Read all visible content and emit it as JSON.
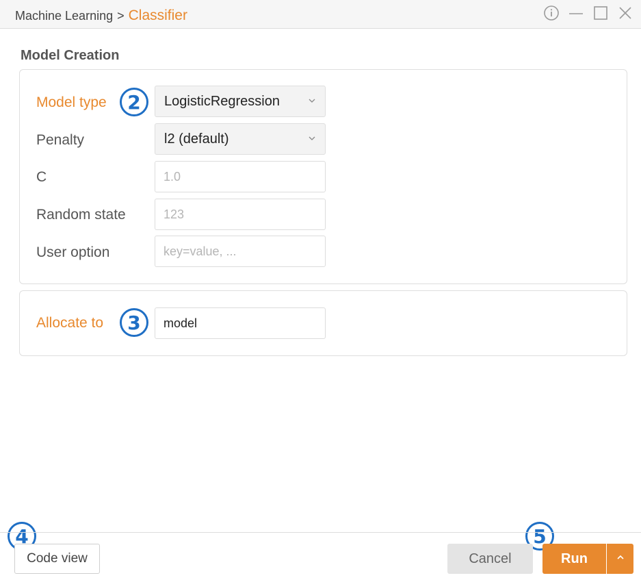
{
  "titlebar": {
    "breadcrumb_parent": "Machine Learning",
    "breadcrumb_sep": ">",
    "breadcrumb_current": "Classifier",
    "controls": [
      "info-icon",
      "minimize-icon",
      "maximize-icon",
      "close-icon"
    ]
  },
  "section_title": "Model Creation",
  "model": {
    "model_type_label": "Model type",
    "model_type_value": "LogisticRegression",
    "penalty_label": "Penalty",
    "penalty_value": "l2 (default)",
    "c_label": "C",
    "c_placeholder": "1.0",
    "random_state_label": "Random state",
    "random_state_placeholder": "123",
    "user_option_label": "User option",
    "user_option_placeholder": "key=value, ..."
  },
  "allocate": {
    "label": "Allocate to",
    "value": "model"
  },
  "badges": {
    "b2": "2",
    "b3": "3",
    "b4": "4",
    "b5": "5"
  },
  "footer": {
    "code_view": "Code view",
    "cancel": "Cancel",
    "run": "Run"
  },
  "colors": {
    "accent": "#e8892e",
    "badge": "#1f6fc5"
  }
}
